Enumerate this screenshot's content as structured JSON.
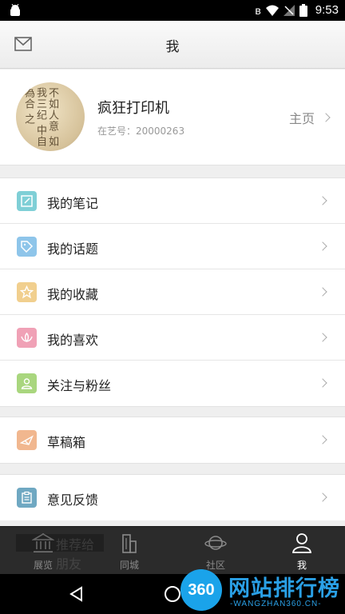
{
  "status_bar": {
    "time": "9:53"
  },
  "header": {
    "title": "我"
  },
  "profile": {
    "name": "疯狂打印机",
    "id_text": "在艺号：20000263",
    "homepage_label": "主页",
    "avatar_calligraphy": "不如人意\n如我三纪\n中自為合\n之\n"
  },
  "menu_groups": [
    [
      {
        "label": "我的笔记",
        "icon": "note-edit-icon",
        "color": "#7fcfd6"
      },
      {
        "label": "我的话题",
        "icon": "tag-icon",
        "color": "#8ec5ea"
      },
      {
        "label": "我的收藏",
        "icon": "star-icon",
        "color": "#f1cf8e"
      },
      {
        "label": "我的喜欢",
        "icon": "lotus-icon",
        "color": "#f0a1b6"
      },
      {
        "label": "关注与粉丝",
        "icon": "user-icon",
        "color": "#a9d67e"
      }
    ],
    [
      {
        "label": "草稿箱",
        "icon": "paper-plane-icon",
        "color": "#f1b78f"
      }
    ],
    [
      {
        "label": "意见反馈",
        "icon": "clipboard-icon",
        "color": "#6fa8c2"
      }
    ]
  ],
  "ghost_row": {
    "label": "推荐给朋友"
  },
  "tabbar": {
    "tabs": [
      {
        "label": "展览",
        "icon": "museum-icon"
      },
      {
        "label": "同城",
        "icon": "buildings-icon"
      },
      {
        "label": "社区",
        "icon": "planet-icon"
      },
      {
        "label": "我",
        "icon": "person-icon"
      }
    ],
    "active_index": 3
  },
  "watermark": {
    "logo_text": "360",
    "title": "网站排行榜",
    "subtitle": "-WANGZHAN360.CN-"
  }
}
